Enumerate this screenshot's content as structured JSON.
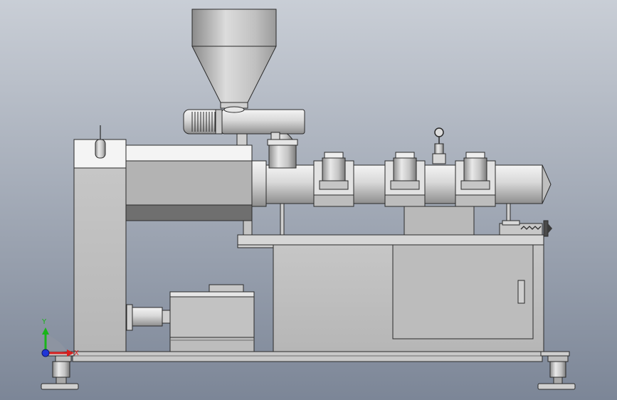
{
  "viewport": {
    "background_top": "#c7ccd4",
    "background_bottom": "#7f8999"
  },
  "triad": {
    "labels": {
      "y": "Y",
      "x": "X"
    },
    "colors": {
      "y": "#19b419",
      "x": "#d82020",
      "z": "#2036d8"
    }
  },
  "model": {
    "name": "single-screw-extruder",
    "colors": {
      "metal_light": "#e6e6e6",
      "metal_mid": "#b9b9b9",
      "metal_dark": "#8f8f8f",
      "panel": "#bdbdbd",
      "outline": "#2a2a2a"
    }
  }
}
